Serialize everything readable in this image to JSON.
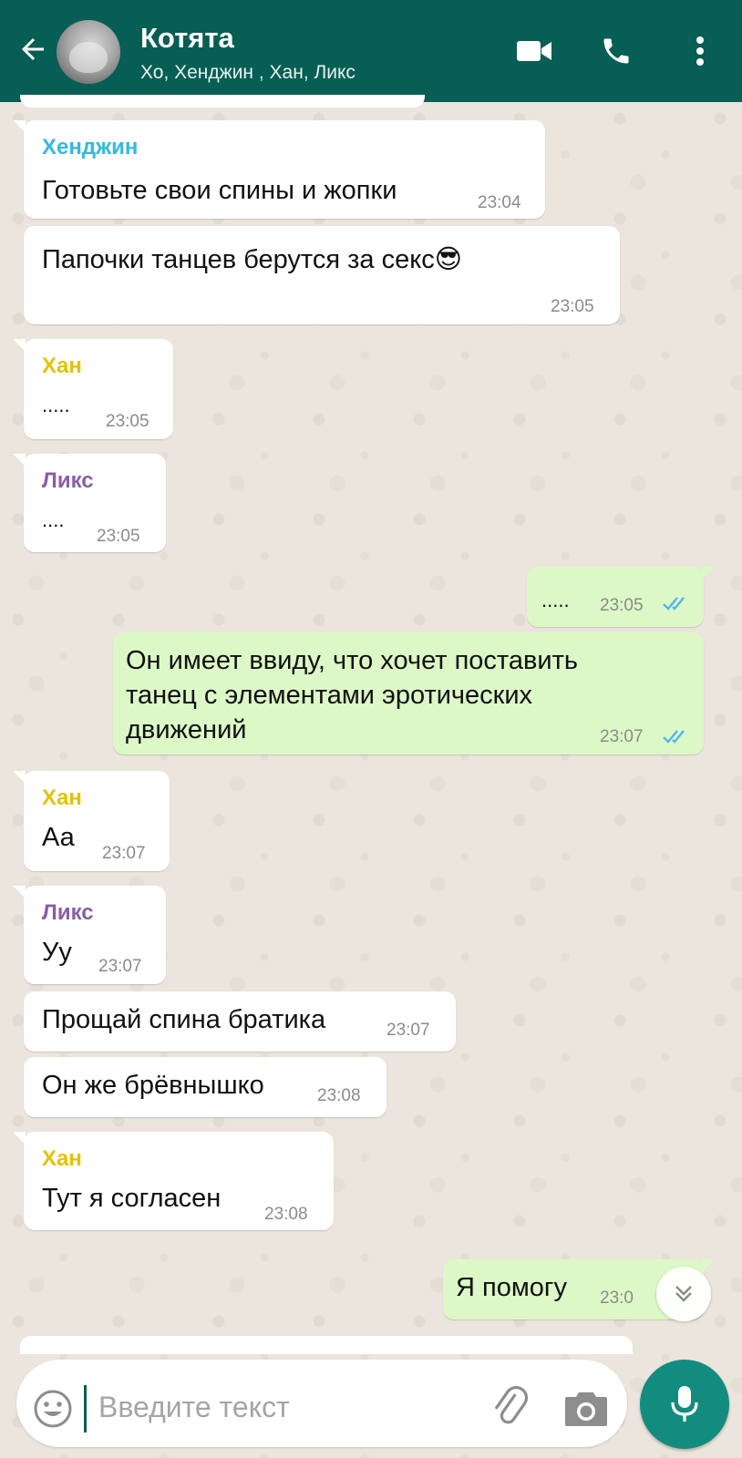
{
  "header": {
    "title": "Котята",
    "subtitle": "Хо, Хенджин , Хан, Ликс",
    "colors": {
      "bar": "#075e54",
      "accent": "#128c7e"
    }
  },
  "messages": [
    {
      "sender": "Хенджин",
      "sender_color": "#35b9e0",
      "text": [
        "Готовьте свои спины и жопки"
      ],
      "time": "23:04",
      "direction": "in"
    },
    {
      "sender": "",
      "text": [
        "Папочки танцев берутся за секс😎"
      ],
      "time": "23:05",
      "direction": "in"
    },
    {
      "sender": "Хан",
      "sender_color": "#e6c200",
      "text": [
        "....."
      ],
      "time": "23:05",
      "direction": "in"
    },
    {
      "sender": "Ликс",
      "sender_color": "#8a5ea6",
      "text": [
        "...."
      ],
      "time": "23:05",
      "direction": "in"
    },
    {
      "sender": "",
      "text": [
        "....."
      ],
      "time": "23:05",
      "direction": "out",
      "status": "read"
    },
    {
      "sender": "",
      "text": [
        "Он имеет ввиду, что хочет поставить",
        "танец с  элементами эротических",
        "движений"
      ],
      "time": "23:07",
      "direction": "out",
      "status": "read"
    },
    {
      "sender": "Хан",
      "sender_color": "#e6c200",
      "text": [
        "Аа"
      ],
      "time": "23:07",
      "direction": "in"
    },
    {
      "sender": "Ликс",
      "sender_color": "#8a5ea6",
      "text": [
        "Уу"
      ],
      "time": "23:07",
      "direction": "in"
    },
    {
      "sender": "",
      "text": [
        "Прощай спина братика"
      ],
      "time": "23:07",
      "direction": "in"
    },
    {
      "sender": "",
      "text": [
        "Он же брёвнышко"
      ],
      "time": "23:08",
      "direction": "in"
    },
    {
      "sender": "Хан",
      "sender_color": "#e6c200",
      "text": [
        "Тут я согласен"
      ],
      "time": "23:08",
      "direction": "in"
    },
    {
      "sender": "",
      "text": [
        "Я помогу"
      ],
      "time": "23:0",
      "direction": "out"
    }
  ],
  "composer": {
    "placeholder": "Введите текст"
  },
  "icons": {
    "back": "arrow-left-icon",
    "video": "video-camera-icon",
    "call": "phone-icon",
    "menu": "more-vertical-icon",
    "emoji": "emoji-icon",
    "attach": "paperclip-icon",
    "camera": "camera-icon",
    "mic": "microphone-icon",
    "scroll": "chevron-double-down-icon"
  }
}
